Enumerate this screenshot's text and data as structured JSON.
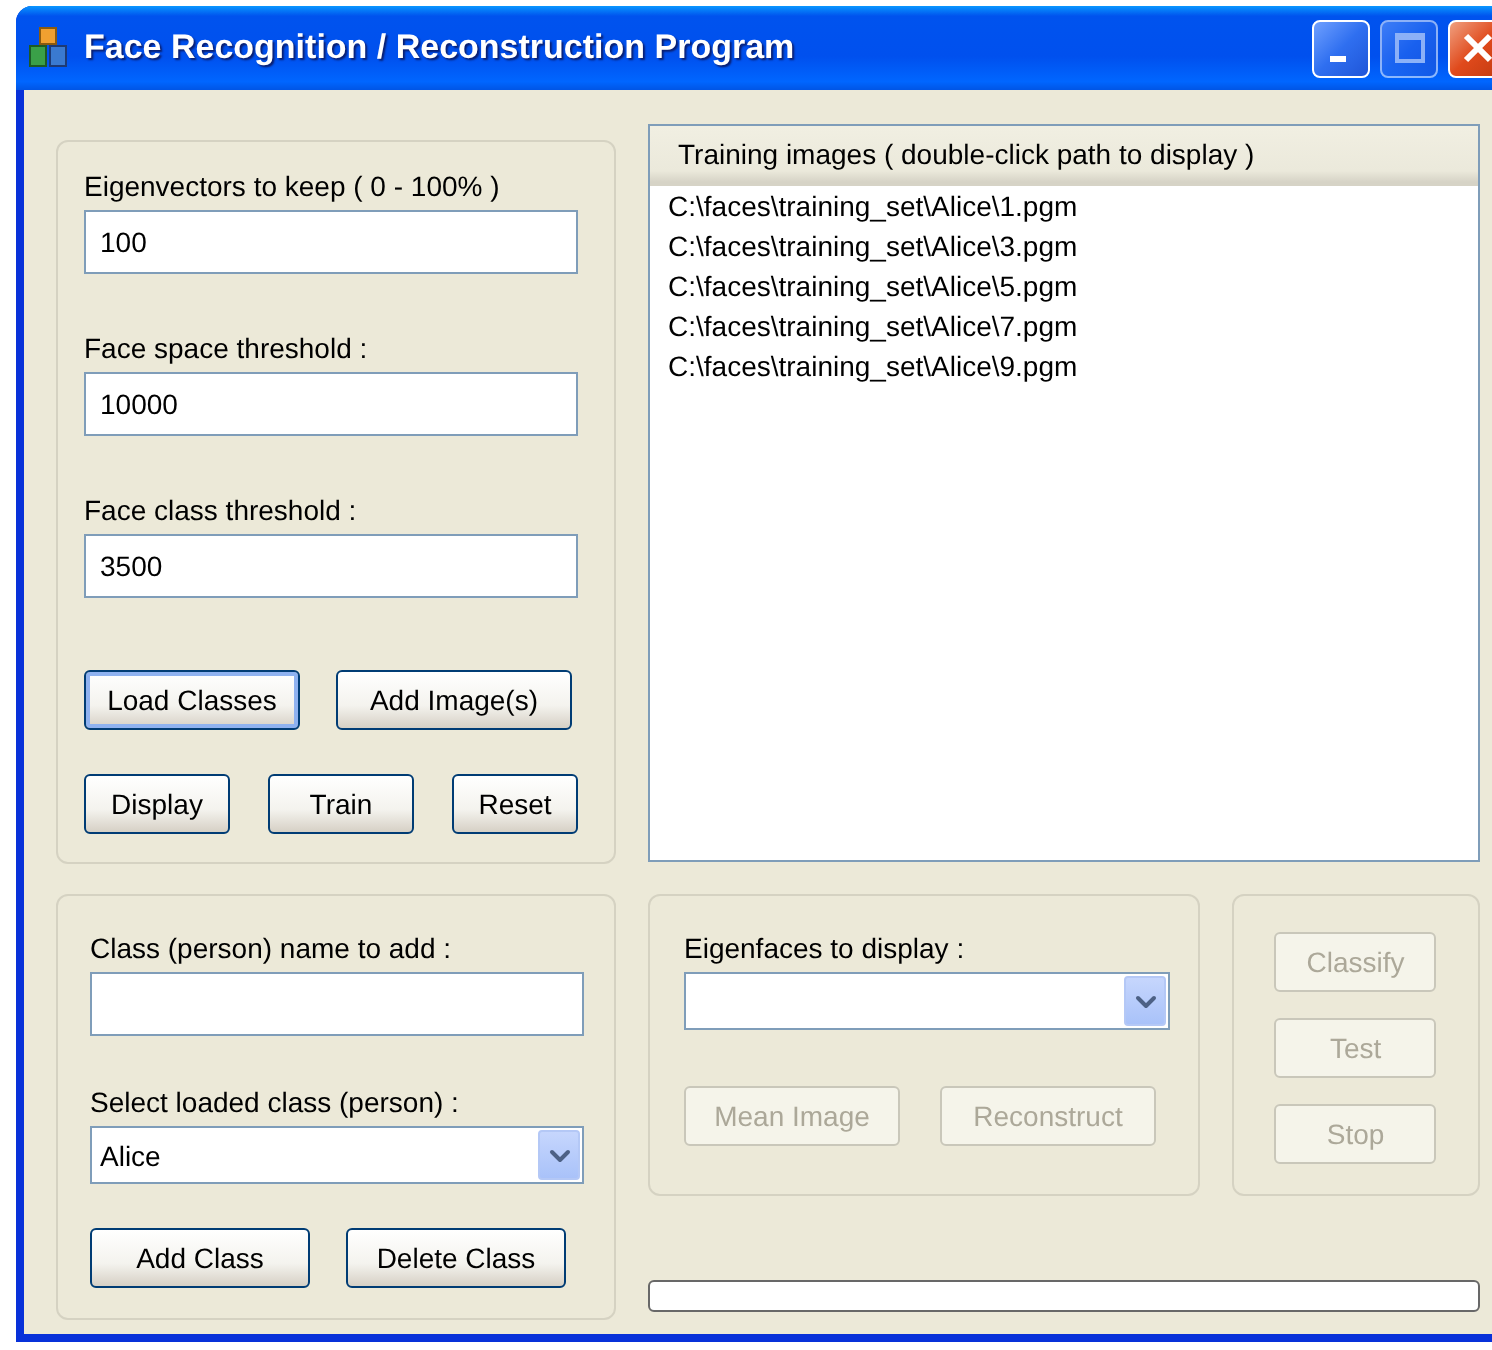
{
  "window": {
    "title": "Face Recognition / Reconstruction Program",
    "controls": [
      {
        "kind": "minimize",
        "disabled": false
      },
      {
        "kind": "maximize",
        "disabled": true
      },
      {
        "kind": "close",
        "disabled": false
      }
    ]
  },
  "settings": {
    "fields": [
      {
        "label": "Eigenvectors to keep ( 0 - 100% )",
        "value": "100"
      },
      {
        "label": "Face space threshold :",
        "value": "10000"
      },
      {
        "label": "Face class threshold :",
        "value": "3500"
      }
    ],
    "button_rows": [
      [
        {
          "label": "Load Classes",
          "disabled": false,
          "focused": true
        },
        {
          "label": "Add Image(s)",
          "disabled": false,
          "focused": false
        }
      ],
      [
        {
          "label": "Display",
          "disabled": false,
          "focused": false
        },
        {
          "label": "Train",
          "disabled": false,
          "focused": false
        },
        {
          "label": "Reset",
          "disabled": false,
          "focused": false
        }
      ]
    ]
  },
  "training_images": {
    "header": "Training images ( double-click path to display )",
    "items": [
      "C:\\faces\\training_set\\Alice\\1.pgm",
      "C:\\faces\\training_set\\Alice\\3.pgm",
      "C:\\faces\\training_set\\Alice\\5.pgm",
      "C:\\faces\\training_set\\Alice\\7.pgm",
      "C:\\faces\\training_set\\Alice\\9.pgm"
    ]
  },
  "class_panel": {
    "name_label": "Class (person) name to add :",
    "select_label": "Select loaded class (person) :",
    "select_value": "Alice",
    "buttons": [
      {
        "label": "Add Class",
        "disabled": false,
        "focused": false
      },
      {
        "label": "Delete Class",
        "disabled": false,
        "focused": false
      }
    ]
  },
  "eigenfaces_panel": {
    "label": "Eigenfaces to display :",
    "buttons": [
      {
        "label": "Mean Image",
        "disabled": true,
        "focused": false
      },
      {
        "label": "Reconstruct",
        "disabled": true,
        "focused": false
      }
    ]
  },
  "actions": {
    "buttons": [
      {
        "label": "Classify",
        "disabled": true,
        "focused": false
      },
      {
        "label": "Test",
        "disabled": true,
        "focused": false
      },
      {
        "label": "Stop",
        "disabled": true,
        "focused": false
      }
    ]
  },
  "progress": {
    "level": 0
  }
}
